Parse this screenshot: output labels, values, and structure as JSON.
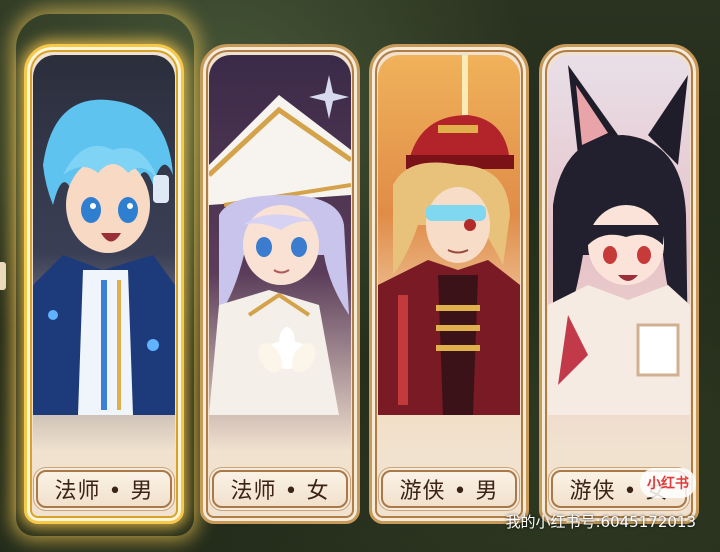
{
  "cards": [
    {
      "label": "法师 • 男",
      "selected": true
    },
    {
      "label": "法师 • 女",
      "selected": false
    },
    {
      "label": "游侠 • 男",
      "selected": false
    },
    {
      "label": "游侠 • 女",
      "selected": false
    }
  ],
  "watermark": {
    "text": "我的小红书号:6045172013",
    "badge": "小红书"
  },
  "colors": {
    "gold_highlight": "#f6c94a",
    "frame": "#c89a5a",
    "label_text": "#3b2416"
  }
}
